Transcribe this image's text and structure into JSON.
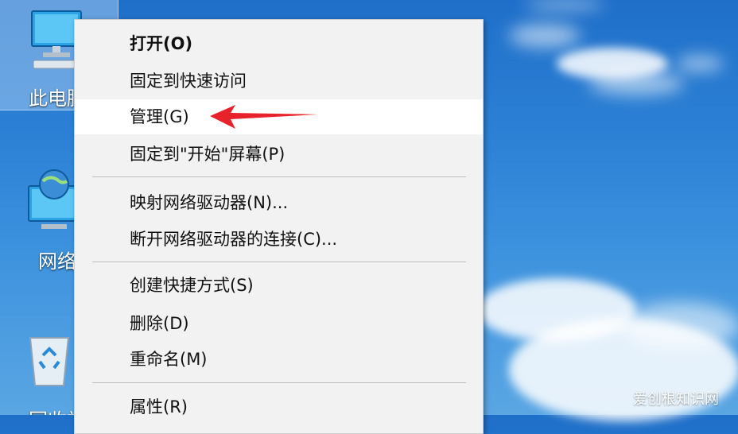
{
  "desktop": {
    "icons": [
      {
        "label": "此电脑",
        "icon": "computer-icon"
      },
      {
        "label": "网络",
        "icon": "network-icon"
      },
      {
        "label": "回收站",
        "icon": "recycle-bin-icon"
      }
    ]
  },
  "context_menu": {
    "items": [
      {
        "label": "打开(O)",
        "bold": true
      },
      {
        "label": "固定到快速访问"
      },
      {
        "label": "管理(G)",
        "highlighted": true
      },
      {
        "label": "固定到\"开始\"屏幕(P)"
      },
      {
        "label": "映射网络驱动器(N)..."
      },
      {
        "label": "断开网络驱动器的连接(C)..."
      },
      {
        "label": "创建快捷方式(S)"
      },
      {
        "label": "删除(D)"
      },
      {
        "label": "重命名(M)"
      },
      {
        "label": "属性(R)"
      }
    ]
  },
  "annotation": {
    "arrow_color": "#e8222a",
    "arrow_target": "管理(G)"
  },
  "watermark": "爱创根知识网"
}
